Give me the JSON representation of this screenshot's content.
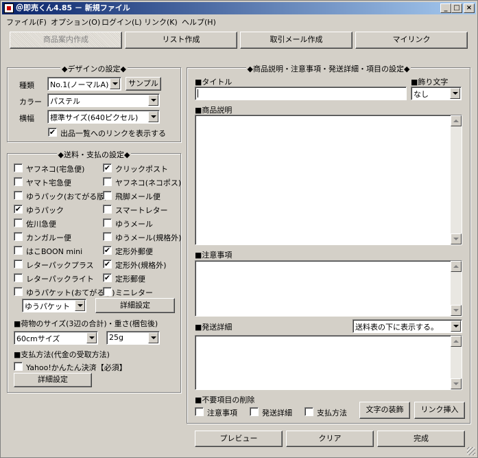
{
  "window": {
    "title": "＠即売くん4.85 － 新規ファイル",
    "controls": [
      "_",
      "□",
      "×"
    ]
  },
  "menu": [
    "ファイル(F)",
    "オプション(O)",
    "ログイン(L)",
    "リンク(K)",
    "ヘルプ(H)"
  ],
  "tabs": [
    {
      "label": "商品案内作成",
      "active": true
    },
    {
      "label": "リスト作成",
      "active": false
    },
    {
      "label": "取引メール作成",
      "active": false
    },
    {
      "label": "マイリンク",
      "active": false
    }
  ],
  "design": {
    "title": "◆デザインの設定◆",
    "type_label": "種類",
    "type_value": "No.1(ノーマルA)",
    "sample_button": "サンプル",
    "color_label": "カラー",
    "color_value": "パステル",
    "width_label": "横幅",
    "width_value": "標準サイズ(640ピクセル)",
    "link_checkbox": {
      "label": "出品一覧へのリンクを表示する",
      "checked": true
    }
  },
  "shipping": {
    "title": "◆送料・支払の設定◆",
    "options": [
      {
        "label": "ヤフネコ(宅急便)",
        "checked": false
      },
      {
        "label": "クリックポスト",
        "checked": true
      },
      {
        "label": "ヤマト宅急便",
        "checked": false
      },
      {
        "label": "ヤフネコ(ネコポス)",
        "checked": false
      },
      {
        "label": "ゆうパック(おてがる版)",
        "checked": false
      },
      {
        "label": "飛脚メール便",
        "checked": false
      },
      {
        "label": "ゆうパック",
        "checked": true
      },
      {
        "label": "スマートレター",
        "checked": false
      },
      {
        "label": "佐川急便",
        "checked": false
      },
      {
        "label": "ゆうメール",
        "checked": false
      },
      {
        "label": "カンガルー便",
        "checked": false
      },
      {
        "label": "ゆうメール(規格外)",
        "checked": false
      },
      {
        "label": "はこBOON mini",
        "checked": false
      },
      {
        "label": "定形外郵便",
        "checked": true
      },
      {
        "label": "レターパックプラス",
        "checked": false
      },
      {
        "label": "定形外(規格外)",
        "checked": true
      },
      {
        "label": "レターパックライト",
        "checked": false
      },
      {
        "label": "定形郵便",
        "checked": true
      },
      {
        "label": "ゆうパケット(おてがる版)",
        "checked": false
      },
      {
        "label": "ミニレター",
        "checked": false
      }
    ],
    "method_value": "ゆうパケット",
    "detail_button": "詳細設定",
    "size_heading": "■荷物のサイズ(3辺の合計)・重さ(梱包後)",
    "size_value": "60cmサイズ",
    "weight_value": "25g",
    "payment_heading": "■支払方法(代金の受取方法)",
    "payment_option": {
      "label": "Yahoo!かんたん決済【必須】",
      "checked": false
    },
    "payment_detail_button": "詳細設定"
  },
  "product": {
    "title": "◆商品説明・注意事項・発送詳細・項目の設定◆",
    "title_label": "■タイトル",
    "title_value": "",
    "decor_label": "■飾り文字",
    "decor_value": "なし",
    "desc_label": "■商品説明",
    "notes_label": "■注意事項",
    "shipping_detail_label": "■発送詳細",
    "shipping_detail_position": "送料表の下に表示する。",
    "remove_label": "■不要項目の削除",
    "remove_options": [
      {
        "label": "注意事項",
        "checked": false
      },
      {
        "label": "発送詳細",
        "checked": false
      },
      {
        "label": "支払方法",
        "checked": false
      }
    ],
    "decorate_button": "文字の装飾",
    "insert_link_button": "リンク挿入"
  },
  "footer": {
    "preview_button": "プレビュー",
    "clear_button": "クリア",
    "done_button": "完成"
  }
}
